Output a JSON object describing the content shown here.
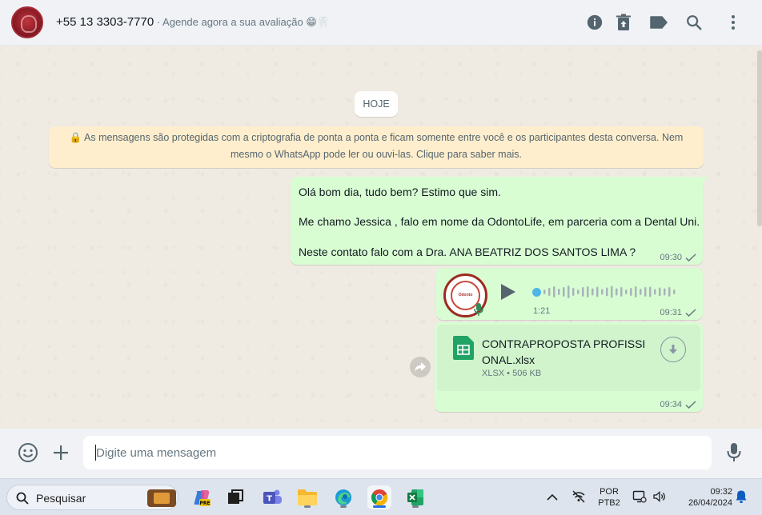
{
  "header": {
    "contact_number": "+55 13 3303-7770",
    "status": " · Agende agora a sua avaliação 😁🦷",
    "icons": [
      "info-icon",
      "delete-icon",
      "label-icon",
      "search-icon",
      "menu-icon"
    ]
  },
  "chat": {
    "date_chip": "HOJE",
    "encryption_notice_line1": "🔒 As mensagens são protegidas com a criptografia de ponta a ponta e ficam somente entre você e os participantes desta conversa. Nem",
    "encryption_notice_line2": "mesmo o WhatsApp pode ler ou ouvi-las. Clique para saber mais.",
    "messages": [
      {
        "lines": [
          "Olá bom dia, tudo bem? Estimo que sim.",
          "Me chamo Jessica , falo em nome da OdontoLife, em parceria com a Dental Uni.",
          "Neste contato falo com a Dra. ANA BEATRIZ DOS SANTOS LIMA ?"
        ],
        "time": "09:30"
      },
      {
        "type": "audio",
        "avatar_text": "Odonto",
        "duration": "1:21",
        "progress": 0.0,
        "time": "09:31"
      },
      {
        "type": "document",
        "file_name": "CONTRAPROPOSTA PROFISSIONAL.xlsx",
        "file_info": "XLSX • 506 KB",
        "time": "09:34"
      }
    ]
  },
  "composer": {
    "placeholder": "Digite uma mensagem",
    "value": ""
  },
  "taskbar": {
    "search_label": "Pesquisar",
    "language_line1": "POR",
    "language_line2": "PTB2",
    "clock_time": "09:32",
    "clock_date": "26/04/2024",
    "colors": {
      "whatsapp_green": "#d9fdd3",
      "taskbar": "#dde4ee"
    }
  }
}
